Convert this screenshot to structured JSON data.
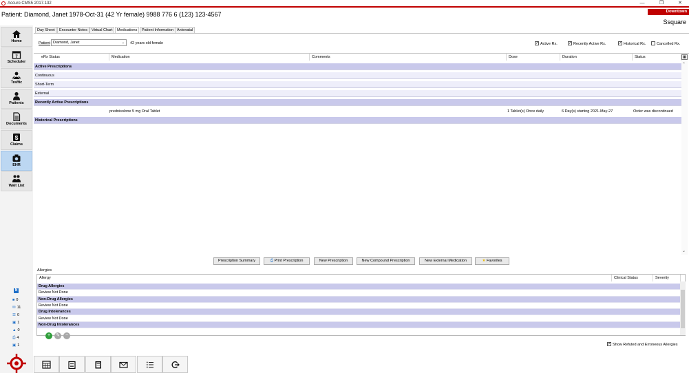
{
  "window": {
    "title": "Accuro CMS5 2017.132",
    "minimize_glyph": "—",
    "restore_glyph": "❒",
    "close_glyph": "✕"
  },
  "header": {
    "patient_banner": "Patient: Diamond, Janet 1978-Oct-31 (42 Yr female) 9988 776 6 (123) 123-4567",
    "location": "Downtown",
    "user": "Ssquare",
    "accent_color": "#c00000"
  },
  "nav": {
    "items": [
      {
        "label": "Home",
        "icon": "home-icon"
      },
      {
        "label": "Scheduler",
        "icon": "calendar-icon"
      },
      {
        "label": "Traffic",
        "icon": "traffic-icon"
      },
      {
        "label": "Patients",
        "icon": "person-icon"
      },
      {
        "label": "Documents",
        "icon": "document-icon"
      },
      {
        "label": "Claims",
        "icon": "dollar-icon"
      },
      {
        "label": "EHR",
        "icon": "camera-icon",
        "active": true
      },
      {
        "label": "Wait List",
        "icon": "people-icon"
      }
    ],
    "active_color": "#bcd7f2"
  },
  "stats": {
    "items": [
      {
        "icon": "tasks-icon",
        "value": "0"
      },
      {
        "icon": "mail-icon",
        "value": "11"
      },
      {
        "icon": "list-icon",
        "value": "0"
      },
      {
        "icon": "document-icon",
        "value": "1"
      },
      {
        "icon": "lab-icon",
        "value": "0"
      },
      {
        "icon": "printer-icon",
        "value": "4"
      },
      {
        "icon": "chat-icon",
        "value": "1"
      }
    ]
  },
  "tabs": [
    {
      "label": "Day Sheet"
    },
    {
      "label": "Encounter Notes"
    },
    {
      "label": "Virtual Chart"
    },
    {
      "label": "Medications",
      "active": true
    },
    {
      "label": "Patient Information"
    },
    {
      "label": "Antenatal"
    }
  ],
  "medications": {
    "patient_label": "Patient",
    "patient_value": "Diamond, Janet",
    "age_text": "42 years old female",
    "filters": [
      {
        "label": "Active Rx.",
        "checked": true
      },
      {
        "label": "Recently Active Rx.",
        "checked": true
      },
      {
        "label": "Historical Rx.",
        "checked": true
      },
      {
        "label": "Cancelled Rx.",
        "checked": false
      }
    ],
    "columns": [
      "eRx Status",
      "Medication",
      "Comments",
      "Dose",
      "Duration",
      "Status"
    ],
    "groups": {
      "active": "Active Prescriptions",
      "continuous": "Continuous",
      "short_term": "Short-Term",
      "external": "External",
      "recent": "Recently Active Prescriptions",
      "historical": "Historical Prescriptions"
    },
    "rows": [
      {
        "erx_status": "",
        "medication": "prednisolone 5 mg Oral Tablet",
        "comments": "",
        "dose": "1 Tablet(s) Once daily",
        "duration": "6 Day(s) starting 2021-May-27",
        "status": "Order was discontinued"
      }
    ],
    "actions": {
      "summary": "Prescription Summary",
      "print": "Print Prescription",
      "new": "New Prescription",
      "compound": "New Compound Prescription",
      "external": "New External Medication",
      "favorites": "Favorites"
    }
  },
  "allergies": {
    "section_label": "Allergies",
    "columns": [
      "Allergy",
      "Clinical Status",
      "Severity"
    ],
    "rows": [
      {
        "label": "Drug Allergies",
        "kind": "major"
      },
      {
        "label": "Review Not Done",
        "kind": "sub"
      },
      {
        "label": "Non-Drug Allergies",
        "kind": "major"
      },
      {
        "label": "Review Not Done",
        "kind": "sub"
      },
      {
        "label": "Drug Intolerances",
        "kind": "major"
      },
      {
        "label": "Review Not Done",
        "kind": "sub"
      },
      {
        "label": "Non-Drug Intolerances",
        "kind": "major"
      }
    ],
    "show_refuted_label": "Show Refuted and Erroneous Allergies",
    "show_refuted_checked": true
  },
  "bottom_toolbar": {
    "buttons": [
      {
        "icon": "calendar-grid-icon"
      },
      {
        "icon": "clipboard-icon"
      },
      {
        "icon": "notebook-icon"
      },
      {
        "icon": "envelope-icon"
      },
      {
        "icon": "checklist-icon"
      },
      {
        "icon": "logout-icon"
      }
    ]
  }
}
